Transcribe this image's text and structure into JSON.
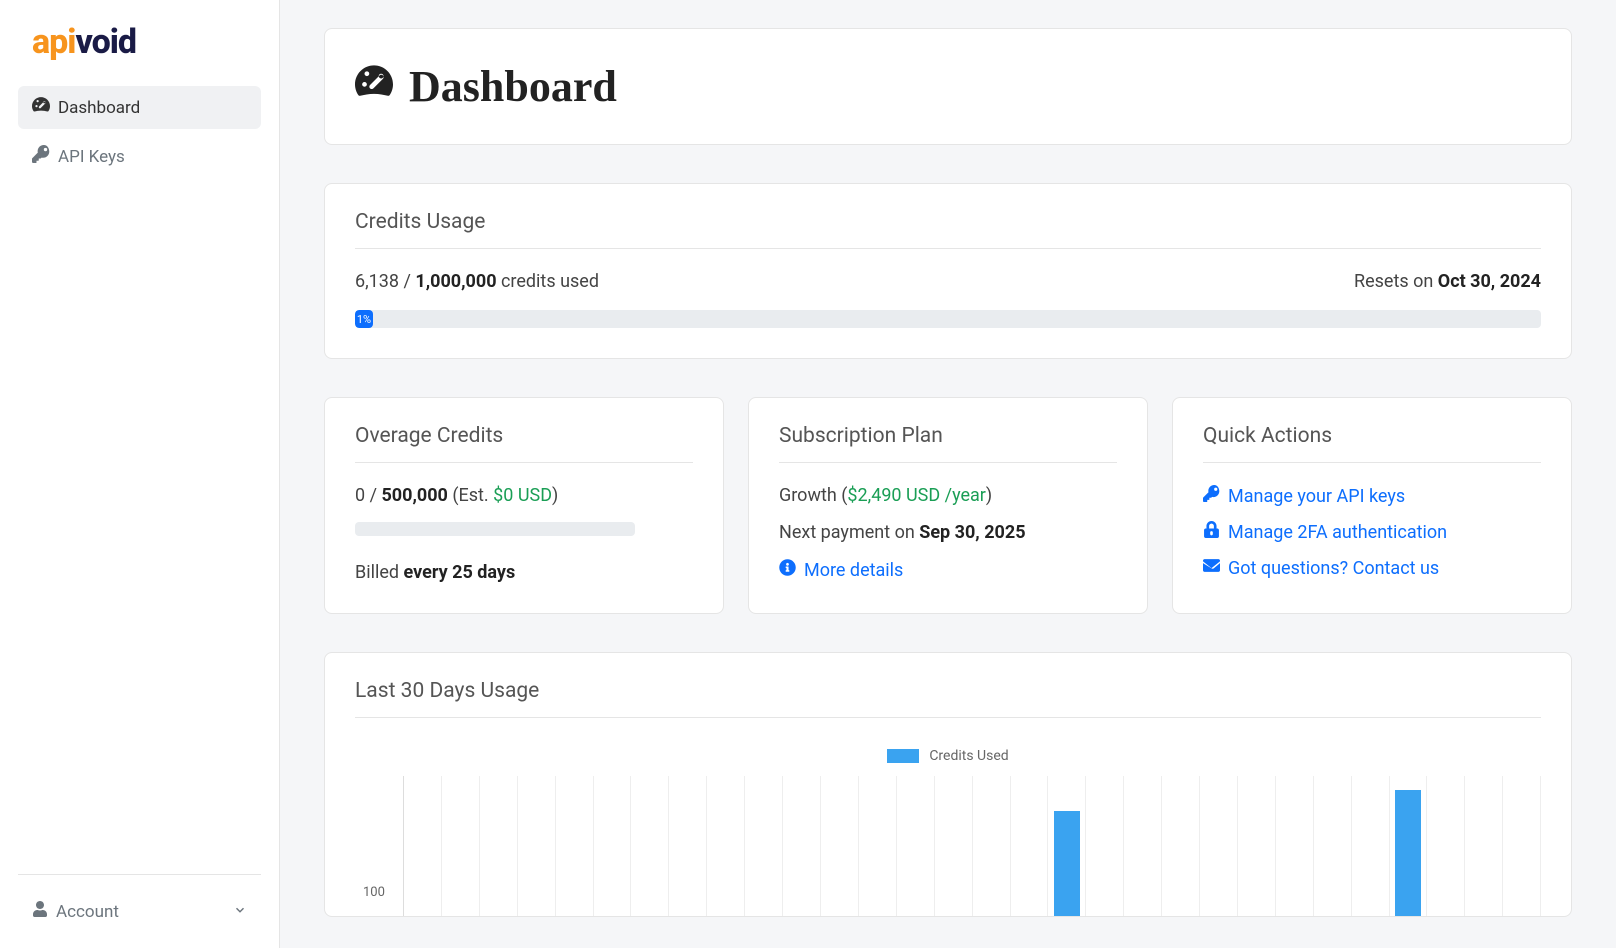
{
  "brand": {
    "name": "apivoid",
    "part1": "api",
    "part2": "void"
  },
  "sidebar": {
    "items": [
      {
        "label": "Dashboard",
        "active": true
      },
      {
        "label": "API Keys",
        "active": false
      }
    ],
    "account_label": "Account"
  },
  "header": {
    "title": "Dashboard"
  },
  "credits": {
    "heading": "Credits Usage",
    "used": "6,138",
    "sep": " / ",
    "total": "1,000,000",
    "suffix": " credits used",
    "resets_prefix": "Resets on ",
    "resets_date": "Oct 30, 2024",
    "percent_label": "1%"
  },
  "overage": {
    "heading": "Overage Credits",
    "used": "0",
    "sep": " / ",
    "total": "500,000",
    "est_prefix": " (Est. ",
    "est_value": "$0 USD",
    "est_suffix": ")",
    "billed_prefix": "Billed ",
    "billed_value": "every 25 days"
  },
  "plan": {
    "heading": "Subscription Plan",
    "name": "Growth",
    "price_prefix": " (",
    "price_value": "$2,490 USD /year",
    "price_suffix": ")",
    "next_prefix": "Next payment on ",
    "next_date": "Sep 30, 2025",
    "more_label": "More details"
  },
  "quick": {
    "heading": "Quick Actions",
    "items": [
      {
        "label": "Manage your API keys",
        "icon": "key"
      },
      {
        "label": "Manage 2FA authentication",
        "icon": "lock"
      },
      {
        "label": "Got questions? Contact us",
        "icon": "mail"
      }
    ]
  },
  "chart": {
    "heading": "Last 30 Days Usage",
    "legend": "Credits Used",
    "y_tick": "100"
  },
  "chart_data": {
    "type": "bar",
    "title": "Last 30 Days Usage",
    "xlabel": "",
    "ylabel": "",
    "ylim": [
      0,
      200
    ],
    "series": [
      {
        "name": "Credits Used",
        "values": [
          0,
          0,
          0,
          0,
          0,
          0,
          0,
          0,
          0,
          0,
          0,
          0,
          0,
          0,
          0,
          0,
          0,
          150,
          0,
          0,
          0,
          0,
          0,
          0,
          0,
          0,
          180,
          0,
          0,
          0
        ]
      }
    ]
  }
}
